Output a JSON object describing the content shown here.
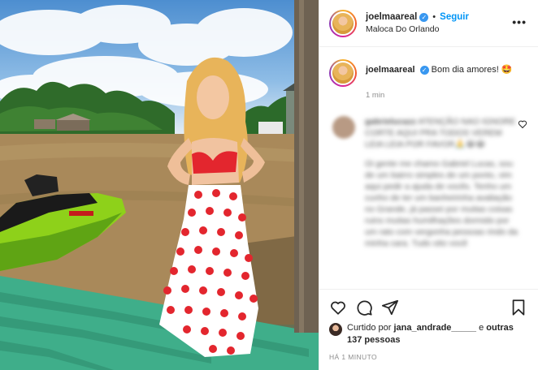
{
  "post": {
    "username": "joelmaareal",
    "follow_label": "Seguir",
    "location": "Maloca Do Orlando",
    "more_label": "•••",
    "caption_text": "Bom dia amores! 🤩",
    "caption_time": "1 min"
  },
  "comment": {
    "username": "gabrielucazz",
    "lines": [
      "ATENÇÃO NAO IGNORE CORTE AQUI PRA TODOS VEREM LEIA LEIA POR FAVOR🙏😭😭",
      "Oi gente me chamo Gabriel Lucas, sou de um bairro simples de um ponto, vim aqui pedir a ajuda de vocês. Tenho um cunho de ter um banheirinha avaliação no Grande, já passei por muitas coisas ruins muitas humilhações dormido por um rato com vergonha pessoas rindo da minha cara. Tudo oito você"
    ]
  },
  "likes": {
    "prefix": "Curtido por",
    "user": "jana_andrade_____",
    "conj": "e",
    "others": "outras 137 pessoas"
  },
  "timestamp": "HÁ 1 MINUTO",
  "icons": {
    "like": "heart-icon",
    "comment": "comment-icon",
    "share": "share-icon",
    "save": "bookmark-icon",
    "verified": "verified-badge-icon"
  },
  "colors": {
    "follow": "#0095f6",
    "verified": "#3897f0",
    "muted": "#8e8e8e",
    "dress_red": "#e3262e"
  }
}
